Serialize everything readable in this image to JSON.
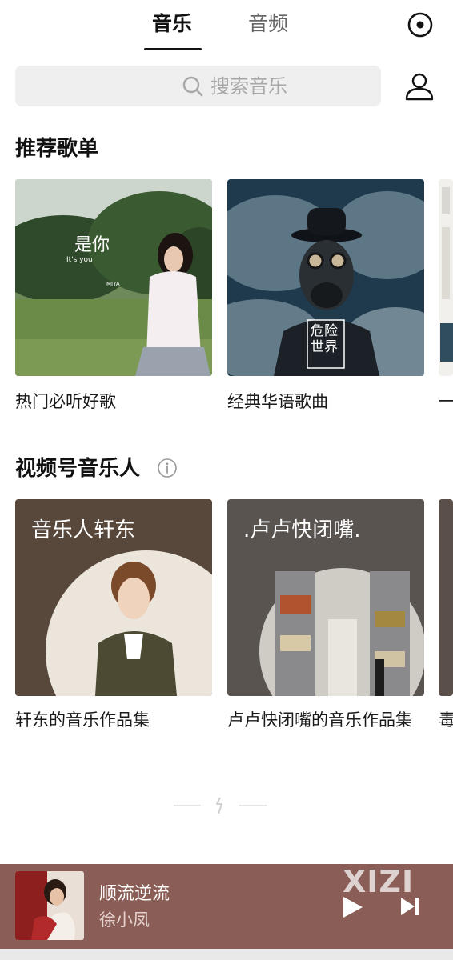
{
  "tabs": {
    "music": "音乐",
    "audio": "音频"
  },
  "search": {
    "placeholder": "搜索音乐"
  },
  "sections": {
    "recommended": {
      "title": "推荐歌单",
      "items": [
        {
          "label": "热门必听好歌",
          "cover_text": "是你",
          "cover_subtext": "It's you",
          "cover_artist": "MIYA"
        },
        {
          "label": "经典华语歌曲",
          "cover_text": "危险世界"
        },
        {
          "label": "一"
        }
      ]
    },
    "musicians": {
      "title": "视频号音乐人",
      "items": [
        {
          "overlay": "音乐人轩东",
          "label": "轩东的音乐作品集"
        },
        {
          "overlay": ".卢卢快闭嘴.",
          "label": "卢卢快闭嘴的音乐作品集"
        },
        {
          "label": "毒"
        }
      ]
    }
  },
  "player": {
    "title": "顺流逆流",
    "artist": "徐小凤",
    "watermark": "XIZI"
  },
  "icons": {
    "record": "record-circle-icon",
    "search": "search-icon",
    "profile": "profile-icon",
    "info": "info-icon",
    "play": "play-icon",
    "next": "next-track-icon"
  },
  "colors": {
    "player_bg": "#8a5e56",
    "artist_card_1": "#57483b",
    "artist_card_2": "#5a5451",
    "search_bg": "#efefef"
  }
}
